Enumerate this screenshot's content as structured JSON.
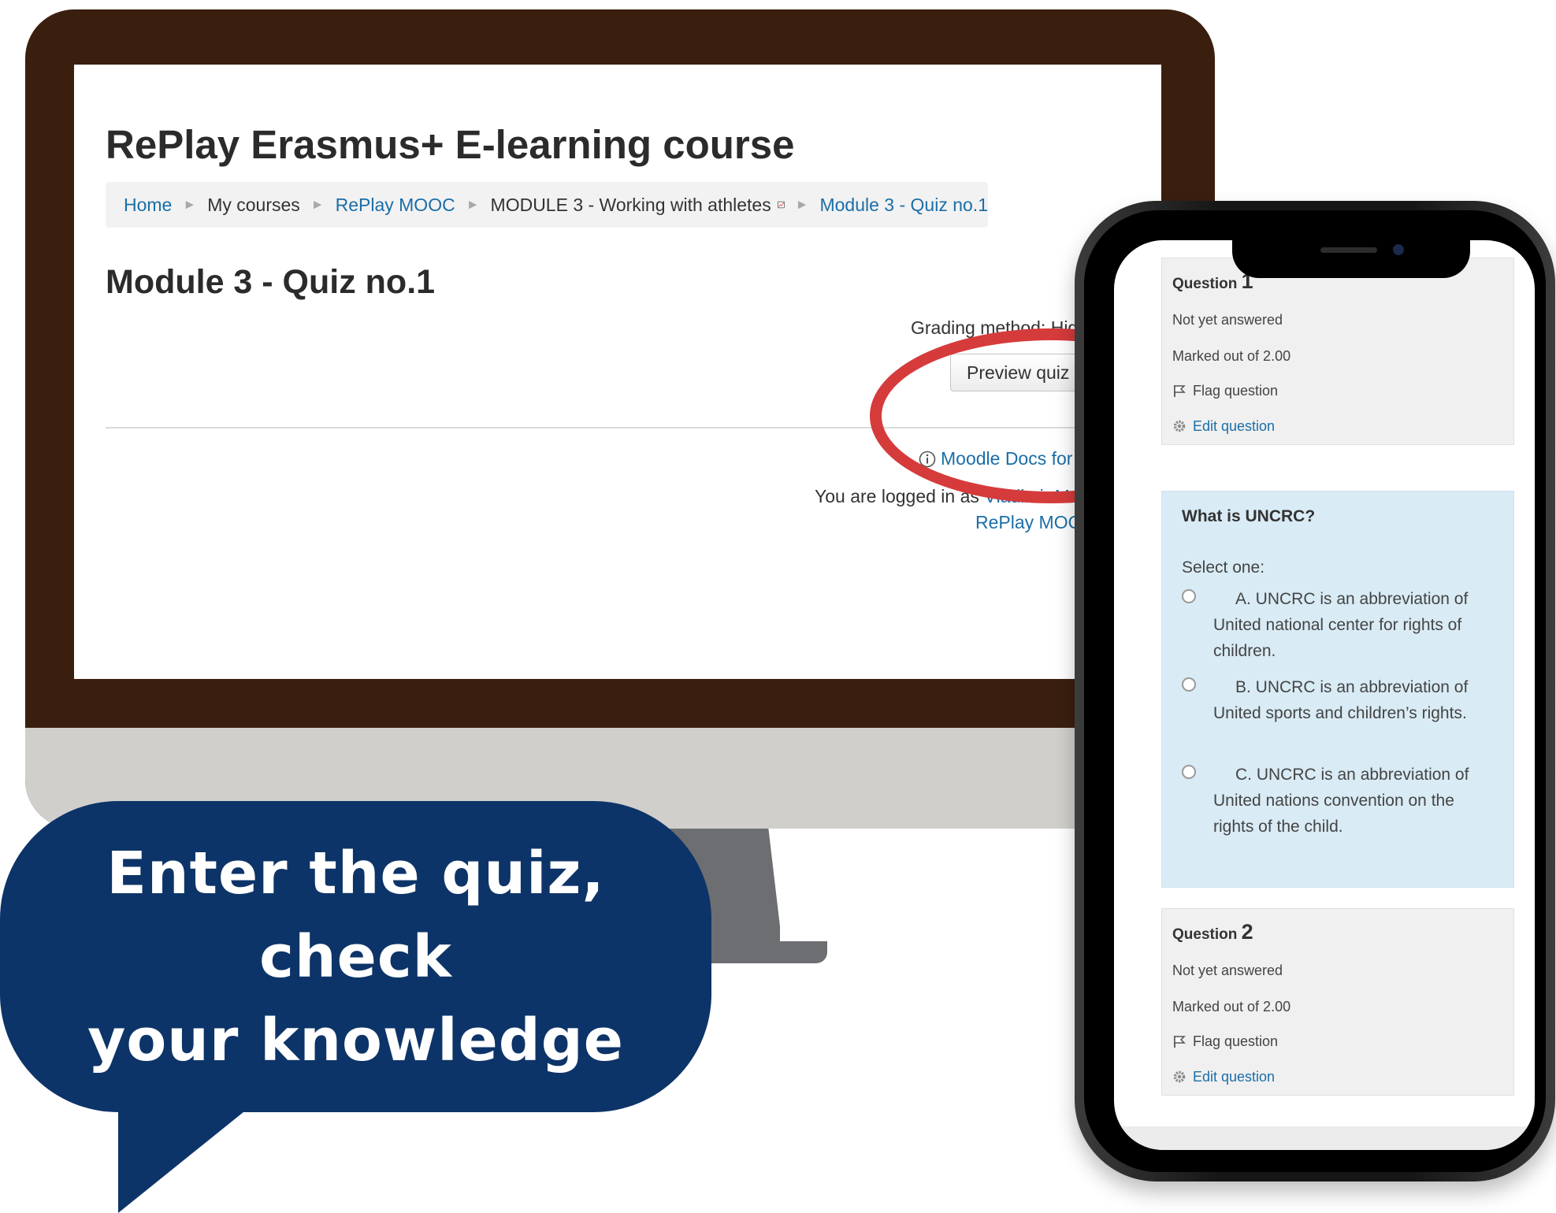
{
  "desktop": {
    "page_title": "RePlay Erasmus+ E-learning course",
    "breadcrumb": {
      "home": "Home",
      "my_courses": "My courses",
      "course": "RePlay MOOC",
      "module": "MODULE 3 - Working with athletes",
      "current": "Module 3 - Quiz no.1",
      "separator": "►"
    },
    "section_title": "Module 3 - Quiz no.1",
    "grading_method": "Grading method: Highes",
    "preview_button": "Preview quiz now",
    "docs_link": "Moodle Docs for this",
    "logged_in_prefix": "You are logged in as ",
    "logged_in_user": "Vladimir Mrd",
    "footer_course_link": "RePlay MOOC"
  },
  "bubble": {
    "line1": "Enter the quiz, check",
    "line2": "your knowledge"
  },
  "phone": {
    "question1": {
      "label": "Question",
      "number": "1",
      "status": "Not yet answered",
      "marked": "Marked out of 2.00",
      "flag": "Flag question",
      "edit": "Edit question"
    },
    "question_text": "What is UNCRC?",
    "prompt": "Select one:",
    "answers": [
      "A. UNCRC is an abbreviation of United national center for rights of children.",
      "B. UNCRC is an abbreviation of United sports and children’s rights.",
      "C. UNCRC is an abbreviation of United nations convention on the rights of the child."
    ],
    "question2": {
      "label": "Question",
      "number": "2",
      "status": "Not yet answered",
      "marked": "Marked out of 2.00",
      "flag": "Flag question",
      "edit": "Edit question"
    }
  },
  "colors": {
    "monitor_frame": "#3a1f0f",
    "bubble": "#0d3468",
    "highlight_ring": "#d63b3b",
    "link": "#1a6ea8",
    "question_bg": "#d9ebf5"
  }
}
